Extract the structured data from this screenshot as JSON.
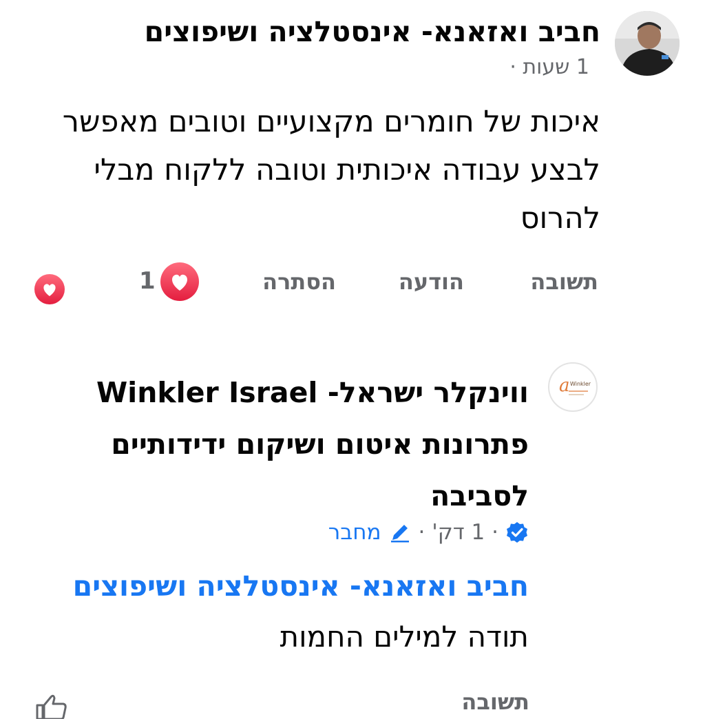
{
  "comment_1": {
    "author": "חביב ואזאנא- אינסטלציה ושיפוצים",
    "time": "1 שעות ·",
    "text": "איכות של חומרים מקצועיים וטובים מאפשר לבצע עבודה איכותית וטובה ללקוח מבלי להרוס",
    "actions": {
      "reply": "תשובה",
      "notify": "הודעה",
      "hide": "הסתרה"
    },
    "reaction_count": "1",
    "avatar_icon": "user-avatar-photo",
    "reaction_icon": "heart-icon"
  },
  "comment_2": {
    "author": "ווינקלר ישראל- Winkler Israel פתרונות איטום ושיקום ידידותיים לסביבה",
    "verified_icon": "verified-badge-icon",
    "time": "· 1 דק' ·",
    "author_label": "מחבר",
    "author_label_icon": "pencil-icon",
    "mention": "חביב ואזאנא- אינסטלציה ושיפוצים",
    "text": "תודה למילים החמות",
    "reply_label": "תשובה",
    "like_icon": "thumbs-up-icon"
  },
  "colors": {
    "link_blue": "#1877f2",
    "meta_gray": "#65676b",
    "heart_red": "#e41e3f",
    "text_black": "#050505"
  }
}
